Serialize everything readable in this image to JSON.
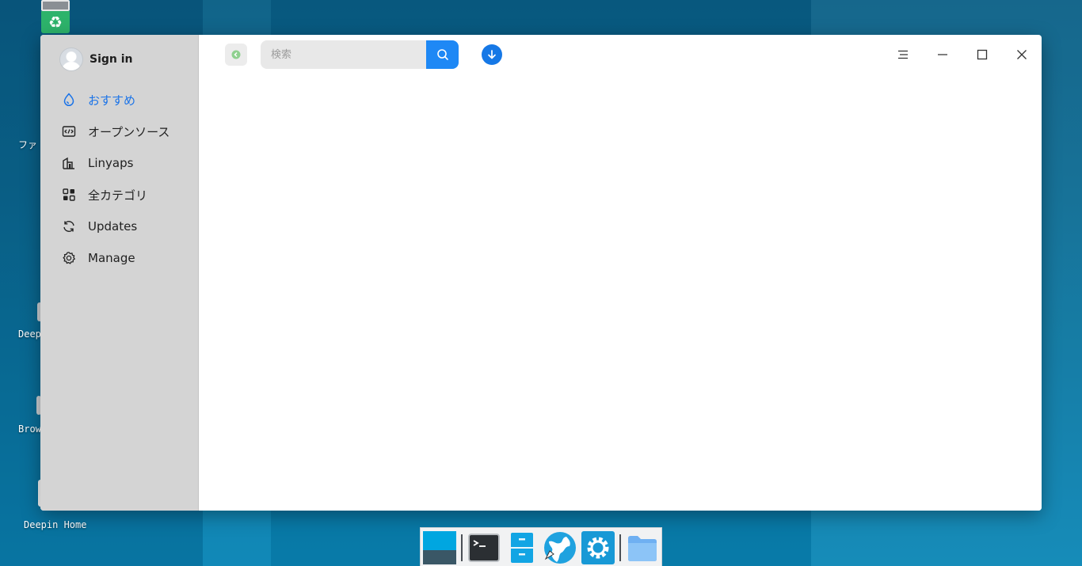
{
  "desktop": {
    "labels": {
      "files_partial": "ファ",
      "deepin_partial": "Deep",
      "browser_partial": "Brow",
      "deepin_home": "Deepin Home"
    },
    "wallpaper_color": "#0a6e99"
  },
  "app": {
    "account": {
      "label": "Sign in"
    },
    "sidebar": {
      "items": [
        {
          "label": "おすすめ",
          "icon": "droplet-icon",
          "active": true
        },
        {
          "label": "オープンソース",
          "icon": "code-icon",
          "active": false
        },
        {
          "label": "Linyaps",
          "icon": "building-icon",
          "active": false
        },
        {
          "label": "全カテゴリ",
          "icon": "grid-icon",
          "active": false
        },
        {
          "label": "Updates",
          "icon": "refresh-icon",
          "active": false
        },
        {
          "label": "Manage",
          "icon": "gear-icon",
          "active": false
        }
      ]
    },
    "toolbar": {
      "search_placeholder": "検索",
      "search_value": ""
    },
    "accent_color": "#1a73e8"
  },
  "dock": {
    "items": [
      {
        "icon": "multitasking-icon"
      },
      {
        "icon": "terminal-icon"
      },
      {
        "icon": "file-manager-icon"
      },
      {
        "icon": "browser-icon"
      },
      {
        "icon": "settings-icon"
      },
      {
        "icon": "folder-icon"
      }
    ]
  }
}
